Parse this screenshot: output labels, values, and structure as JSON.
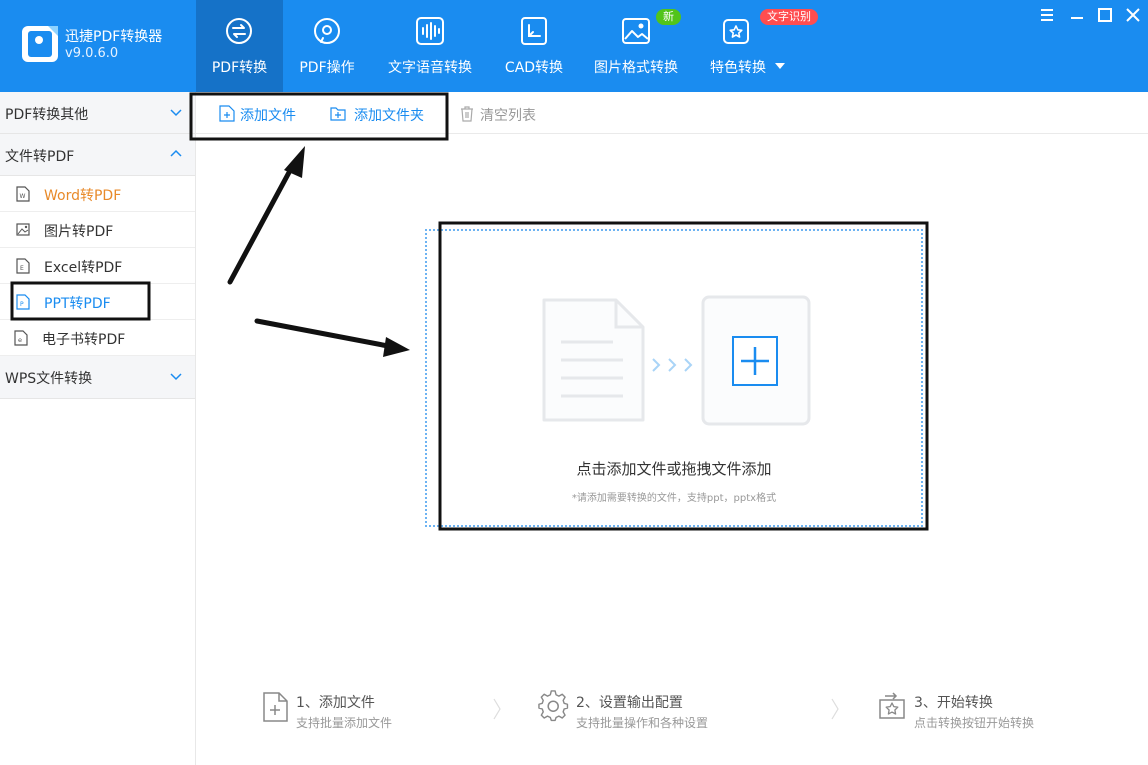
{
  "app": {
    "name": "迅捷PDF转换器",
    "version": "v9.0.6.0"
  },
  "nav": [
    {
      "label": "PDF转换",
      "icon": "pdf-convert-icon"
    },
    {
      "label": "PDF操作",
      "icon": "pdf-operate-icon"
    },
    {
      "label": "文字语音转换",
      "icon": "voice-wave-icon"
    },
    {
      "label": "CAD转换",
      "icon": "cad-icon"
    },
    {
      "label": "图片格式转换",
      "icon": "image-icon"
    },
    {
      "label": "特色转换",
      "icon": "star-convert-icon"
    }
  ],
  "badges": {
    "new": "新",
    "ocr": "文字识别"
  },
  "sidebar": {
    "groups": [
      {
        "label": "PDF转换其他",
        "expanded": false
      },
      {
        "label": "文件转PDF",
        "expanded": true
      },
      {
        "label": "WPS文件转换",
        "expanded": false
      }
    ],
    "items": [
      {
        "label": "Word转PDF",
        "icon": "word-file-icon"
      },
      {
        "label": "图片转PDF",
        "icon": "image-file-icon"
      },
      {
        "label": "Excel转PDF",
        "icon": "excel-file-icon"
      },
      {
        "label": "PPT转PDF",
        "icon": "ppt-file-icon",
        "selected": true
      },
      {
        "label": "电子书转PDF",
        "icon": "ebook-file-icon"
      }
    ]
  },
  "toolbar": {
    "add_file": "添加文件",
    "add_folder": "添加文件夹",
    "clear_list": "清空列表"
  },
  "dropzone": {
    "title": "点击添加文件或拖拽文件添加",
    "hint": "*请添加需要转换的文件，支持ppt，pptx格式"
  },
  "steps": [
    {
      "title": "1、添加文件",
      "desc": "支持批量添加文件"
    },
    {
      "title": "2、设置输出配置",
      "desc": "支持批量操作和各种设置"
    },
    {
      "title": "3、开始转换",
      "desc": "点击转换按钮开始转换"
    }
  ],
  "colors": {
    "brand": "#1a8cf0",
    "selected_item": "#1a8cf0",
    "highlight_item": "#e88a2a",
    "badge_new": "#52c41a",
    "badge_ocr": "#ff4d4f"
  }
}
